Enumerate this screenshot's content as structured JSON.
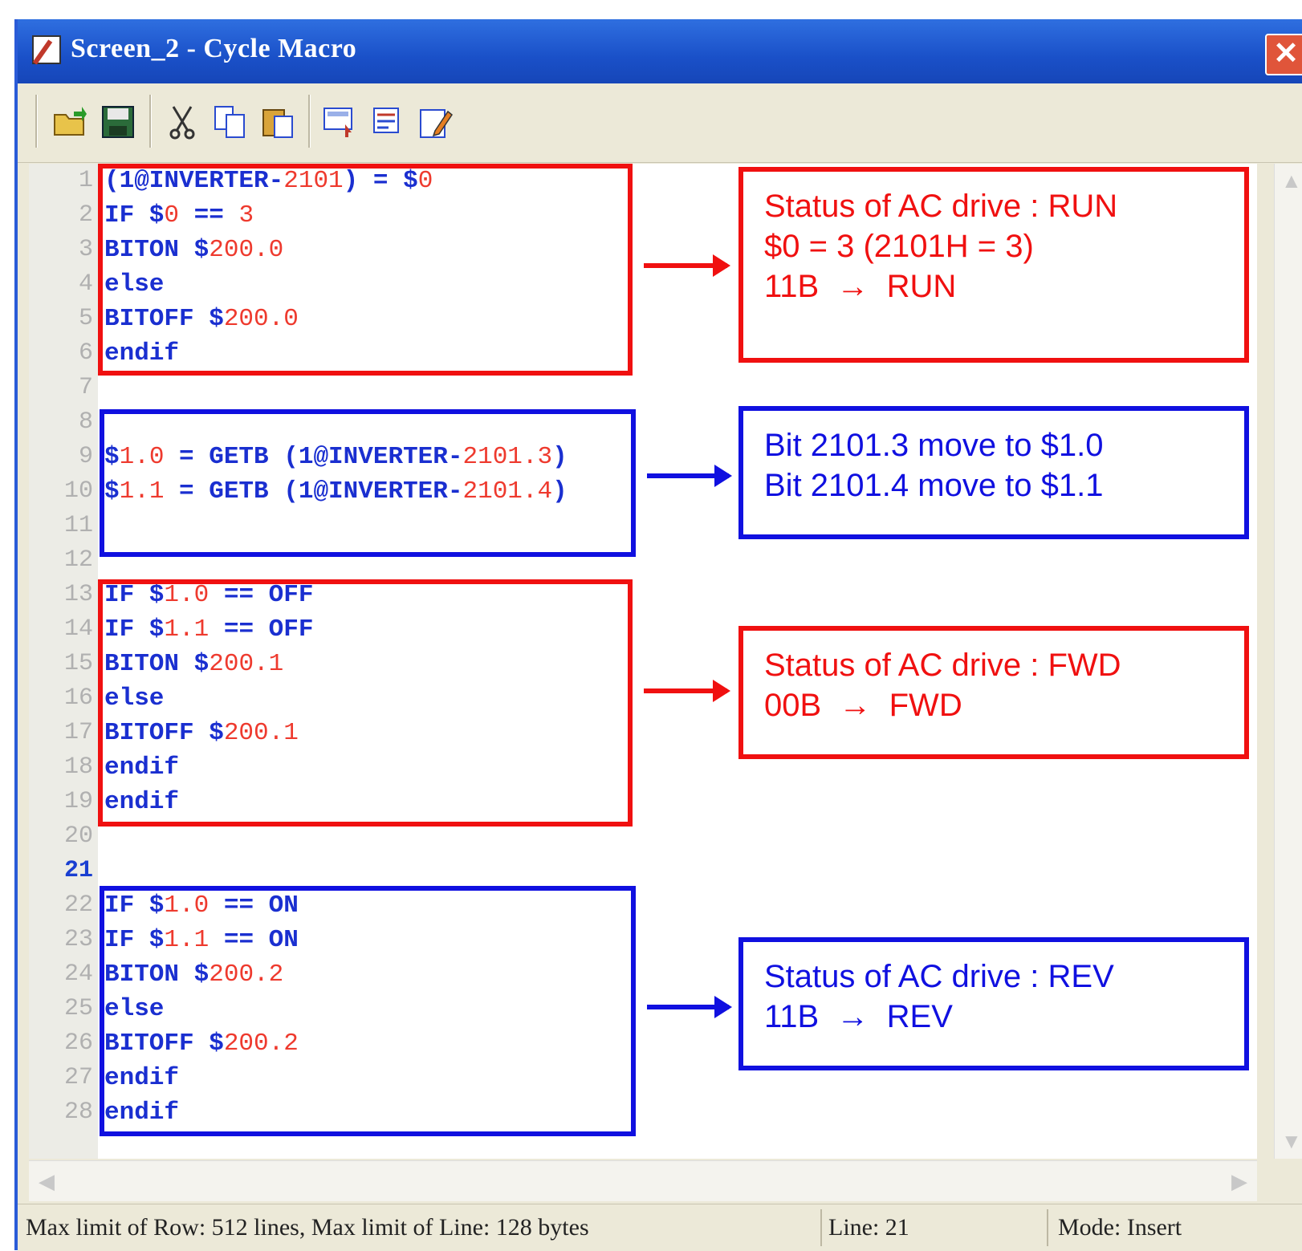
{
  "window": {
    "title": "Screen_2 - Cycle Macro",
    "close_label": "✕"
  },
  "toolbar": {
    "buttons": [
      "open",
      "save",
      "cut",
      "copy",
      "paste",
      "insert-command",
      "import",
      "edit-properties"
    ]
  },
  "editor": {
    "current_line": 21,
    "line_numbers": [
      "1",
      "2",
      "3",
      "4",
      "5",
      "6",
      "7",
      "8",
      "9",
      "10",
      "11",
      "12",
      "13",
      "14",
      "15",
      "16",
      "17",
      "18",
      "19",
      "20",
      "21",
      "22",
      "23",
      "24",
      "25",
      "26",
      "27",
      "28"
    ],
    "lines": [
      [
        "(1@INVERTER-",
        "2101",
        ") = $",
        "0"
      ],
      [
        "IF $",
        "0",
        " == ",
        "3"
      ],
      [
        "BITON $",
        "200.0"
      ],
      [
        "else"
      ],
      [
        "BITOFF $",
        "200.0"
      ],
      [
        "endif"
      ],
      [],
      [],
      [
        "$",
        "1.0",
        " = GETB (1@INVERTER-",
        "2101.3",
        ")"
      ],
      [
        "$",
        "1.1",
        " = GETB (1@INVERTER-",
        "2101.4",
        ")"
      ],
      [],
      [],
      [
        "IF $",
        "1.0",
        " == OFF"
      ],
      [
        "IF $",
        "1.1",
        " == OFF"
      ],
      [
        "BITON $",
        "200.1"
      ],
      [
        "else"
      ],
      [
        "BITOFF $",
        "200.1"
      ],
      [
        "endif"
      ],
      [
        "endif"
      ],
      [],
      [],
      [
        "IF $",
        "1.0",
        " == ON"
      ],
      [
        "IF $",
        "1.1",
        " == ON"
      ],
      [
        "BITON $",
        "200.2"
      ],
      [
        "else"
      ],
      [
        "BITOFF $",
        "200.2"
      ],
      [
        "endif"
      ],
      [
        "endif"
      ]
    ]
  },
  "annotations": [
    {
      "color": "red",
      "lines": [
        "Status of AC drive : RUN",
        "$0 = 3 (2101H = 3)",
        "11B  →  RUN"
      ]
    },
    {
      "color": "blue",
      "lines": [
        "Bit 2101.3 move to $1.0",
        "Bit 2101.4 move to $1.1"
      ]
    },
    {
      "color": "red",
      "lines": [
        "Status of AC drive : FWD",
        "00B  →  FWD"
      ]
    },
    {
      "color": "blue",
      "lines": [
        "Status of AC drive : REV",
        "11B  →  REV"
      ]
    }
  ],
  "statusbar": {
    "limits": "Max limit of Row: 512 lines, Max limit of Line: 128 bytes",
    "line": "Line: 21",
    "mode": "Mode: Insert"
  },
  "colors": {
    "red": "#f01010",
    "blue": "#1010e0",
    "titlebar": "#1a50c8"
  }
}
